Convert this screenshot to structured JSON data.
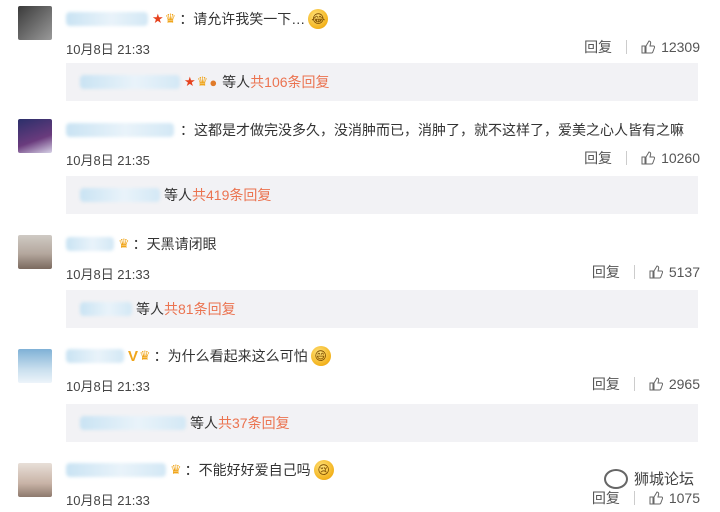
{
  "comments": [
    {
      "text": "：请允许我笑一下…",
      "emoji": "laughing-crying",
      "date": "10月8日 21:33",
      "reply_label": "回复",
      "likes": "12309",
      "badges": [
        "star",
        "crown"
      ],
      "replies": {
        "others_label": "等人",
        "count_label": "共106条回复",
        "badges": [
          "star",
          "crown",
          "balloon"
        ]
      }
    },
    {
      "text": "：这都是才做完没多久，没消肿而已，消肿了，就不这样了，爱美之心人皆有之嘛",
      "emoji": "",
      "date": "10月8日 21:35",
      "reply_label": "回复",
      "likes": "10260",
      "badges": [],
      "replies": {
        "others_label": "等人",
        "count_label": "共419条回复",
        "badges": []
      }
    },
    {
      "text": "：天黑请闭眼",
      "emoji": "",
      "date": "10月8日 21:33",
      "reply_label": "回复",
      "likes": "5137",
      "badges": [
        "crown"
      ],
      "replies": {
        "others_label": "等人",
        "count_label": "共81条回复",
        "badges": []
      }
    },
    {
      "text": "：为什么看起来这么可怕",
      "emoji": "grinning",
      "date": "10月8日 21:33",
      "reply_label": "回复",
      "likes": "2965",
      "badges": [
        "v",
        "crown"
      ],
      "replies": {
        "others_label": "等人",
        "count_label": "共37条回复",
        "badges": []
      }
    },
    {
      "text": "：不能好好爱自己吗",
      "emoji": "sad",
      "date": "10月8日 21:33",
      "reply_label": "回复",
      "likes": "1075",
      "badges": [
        "crown"
      ],
      "replies": null
    }
  ],
  "watermark": {
    "text": "狮城论坛",
    "icon": "wechat-icon"
  },
  "colors": {
    "accent": "#eb7350",
    "reply_bg": "#f2f2f5"
  }
}
